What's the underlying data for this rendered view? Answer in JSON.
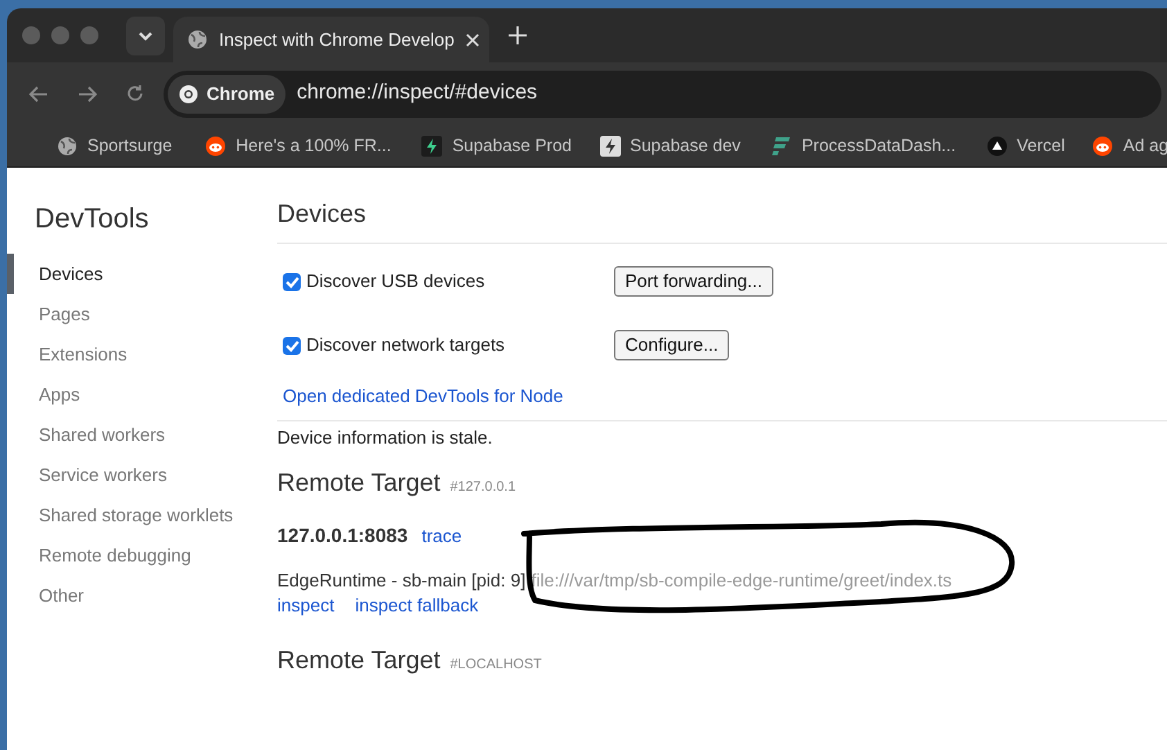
{
  "browser": {
    "tabs": [
      {
        "title": "Inspect with Chrome Develop",
        "selected": true
      }
    ],
    "address": {
      "chip": "Chrome",
      "url": "chrome://inspect/#devices"
    },
    "bookmarks": [
      {
        "label": "Sportsurge",
        "kind": "globe"
      },
      {
        "label": "Here's a 100% FR...",
        "kind": "reddit"
      },
      {
        "label": "Supabase Prod",
        "kind": "bolt-dark"
      },
      {
        "label": "Supabase dev",
        "kind": "bolt-light"
      },
      {
        "label": "ProcessDataDash...",
        "kind": "stripes"
      },
      {
        "label": "Vercel",
        "kind": "triangle"
      },
      {
        "label": "Ad ag",
        "kind": "reddit"
      }
    ]
  },
  "sidebar": {
    "title": "DevTools",
    "items": [
      {
        "label": "Devices",
        "selected": true
      },
      {
        "label": "Pages",
        "selected": false
      },
      {
        "label": "Extensions",
        "selected": false
      },
      {
        "label": "Apps",
        "selected": false
      },
      {
        "label": "Shared workers",
        "selected": false
      },
      {
        "label": "Service workers",
        "selected": false
      },
      {
        "label": "Shared storage worklets",
        "selected": false
      },
      {
        "label": "Remote debugging",
        "selected": false
      },
      {
        "label": "Other",
        "selected": false
      }
    ]
  },
  "main": {
    "title": "Devices",
    "options": [
      {
        "label": "Discover USB devices",
        "checked": true,
        "button": "Port forwarding..."
      },
      {
        "label": "Discover network targets",
        "checked": true,
        "button": "Configure..."
      }
    ],
    "node_link": "Open dedicated DevTools for Node",
    "status": "Device information is stale.",
    "targets": [
      {
        "title": "Remote Target",
        "id": "#127.0.0.1",
        "devices": [
          {
            "address": "127.0.0.1:8083",
            "action": "trace",
            "processes": [
              {
                "name": "EdgeRuntime - sb-main [pid: 9]",
                "url": "file:///var/tmp/sb-compile-edge-runtime/greet/index.ts",
                "actions": [
                  "inspect",
                  "inspect fallback"
                ]
              }
            ]
          }
        ]
      },
      {
        "title": "Remote Target",
        "id": "#LOCALHOST"
      }
    ]
  }
}
